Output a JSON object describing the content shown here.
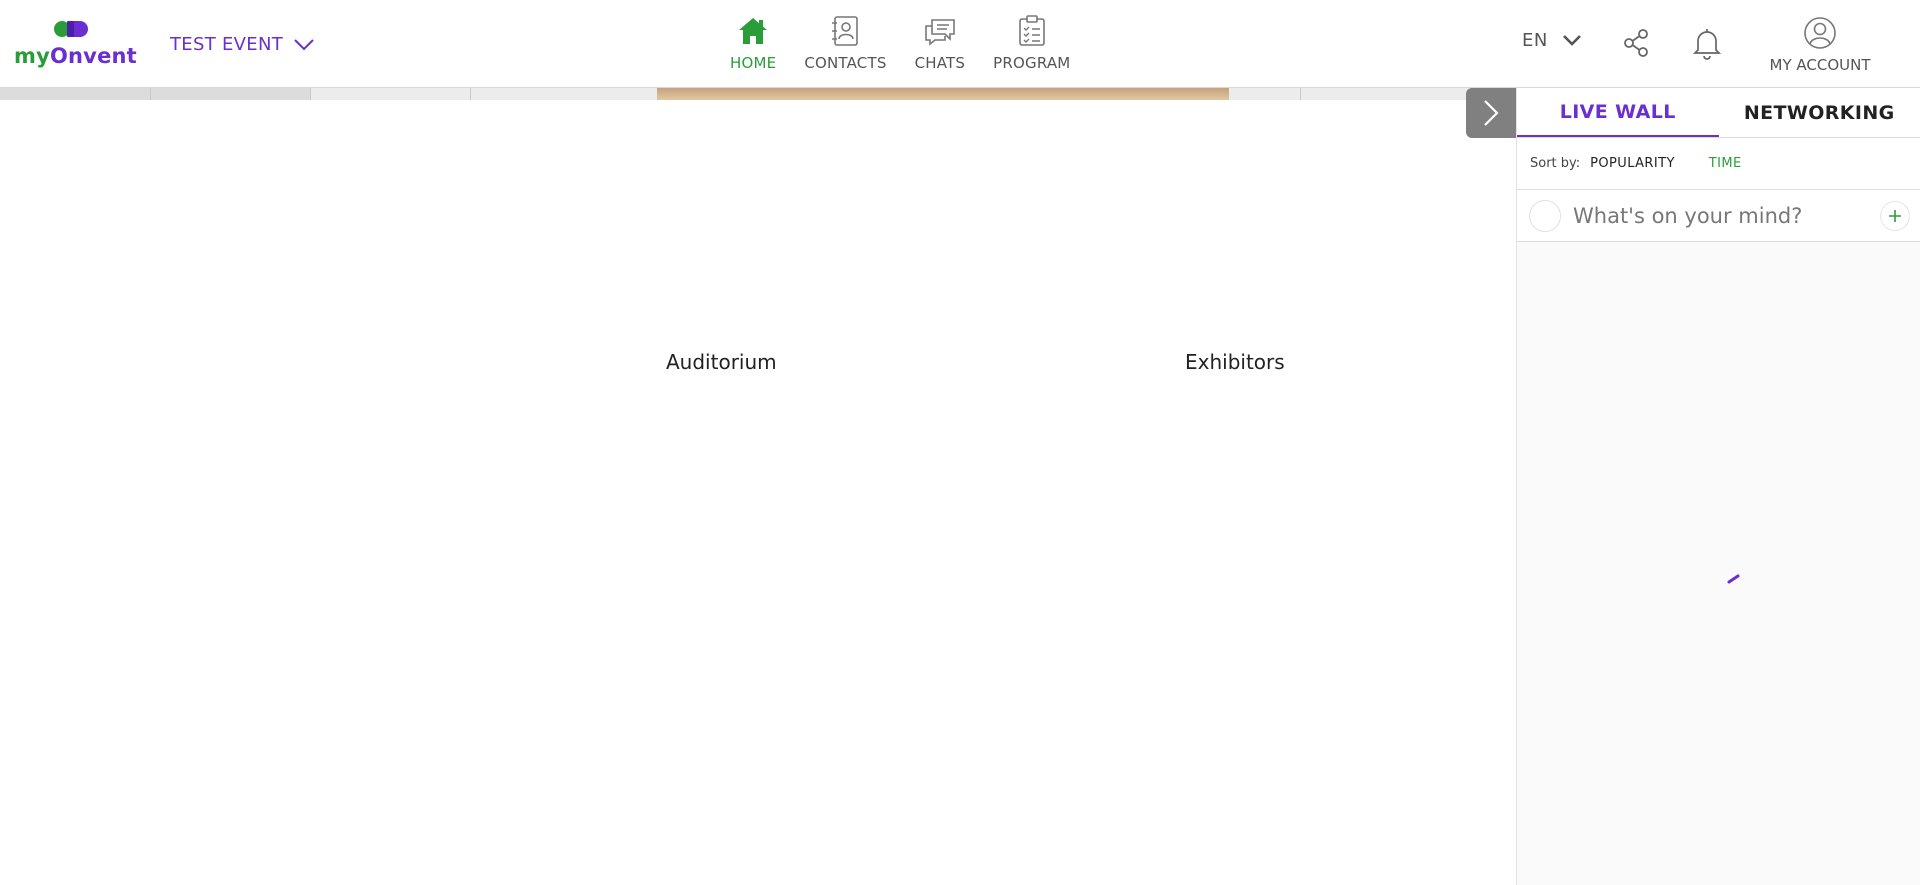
{
  "brand": {
    "my": "my",
    "onvent": "Onvent",
    "colors": {
      "green": "#2a9d3a",
      "purple": "#6a2fd0"
    }
  },
  "event": {
    "name": "TEST EVENT",
    "icon": "chevron-down-icon"
  },
  "nav": {
    "items": [
      {
        "label": "HOME",
        "icon": "home-icon",
        "active": true
      },
      {
        "label": "CONTACTS",
        "icon": "contacts-icon",
        "active": false
      },
      {
        "label": "CHATS",
        "icon": "chats-icon",
        "active": false
      },
      {
        "label": "PROGRAM",
        "icon": "program-icon",
        "active": false
      }
    ]
  },
  "header": {
    "language": "EN",
    "share_icon": "share-icon",
    "notifications_icon": "bell-icon",
    "account_label": "MY ACCOUNT",
    "account_icon": "user-icon"
  },
  "lobby": {
    "rooms": [
      {
        "label": "Auditorium"
      },
      {
        "label": "Exhibitors"
      }
    ],
    "collapse_icon": "chevron-right-icon"
  },
  "sidebar": {
    "tabs": [
      {
        "label": "LIVE WALL",
        "active": true
      },
      {
        "label": "NETWORKING",
        "active": false
      }
    ],
    "sort": {
      "label": "Sort by:",
      "options": [
        {
          "label": "POPULARITY",
          "selected": false
        },
        {
          "label": "TIME",
          "selected": true
        }
      ]
    },
    "composer": {
      "placeholder": "What's on your mind?",
      "add_icon": "plus-icon"
    }
  }
}
